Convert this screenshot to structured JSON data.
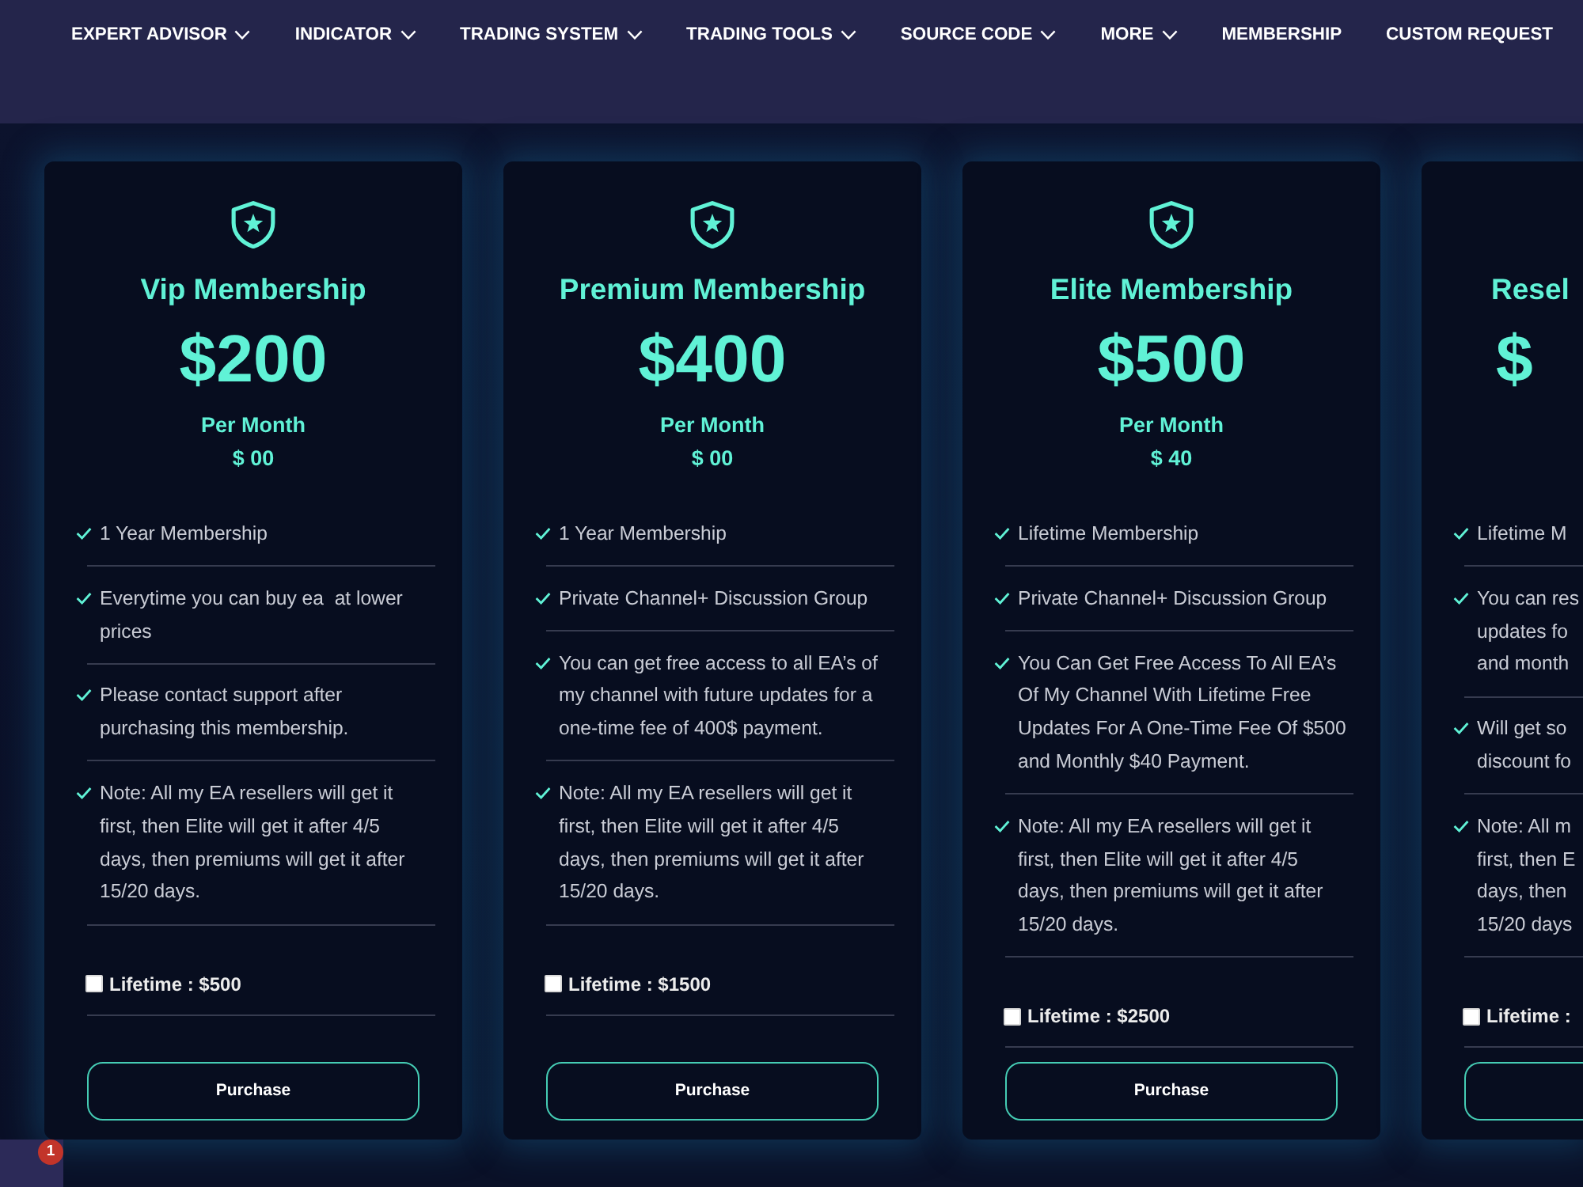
{
  "nav": {
    "items": [
      {
        "label": "EXPERT ADVISOR",
        "dropdown": true
      },
      {
        "label": "INDICATOR",
        "dropdown": true
      },
      {
        "label": "TRADING SYSTEM",
        "dropdown": true
      },
      {
        "label": "TRADING TOOLS",
        "dropdown": true
      },
      {
        "label": "SOURCE CODE",
        "dropdown": true
      },
      {
        "label": "MORE",
        "dropdown": true
      },
      {
        "label": "MEMBERSHIP",
        "dropdown": false
      },
      {
        "label": "CUSTOM REQUEST",
        "dropdown": false
      }
    ]
  },
  "plans": [
    {
      "kind": "full",
      "title": "Vip Membership",
      "price": "$200",
      "period": "Per Month",
      "monthly": "$ 00",
      "items": [
        "1 Year Membership",
        "Everytime you can buy ea  at lower\nprices",
        "Please contact support after\npurchasing this membership.",
        "Note: All my EA resellers will get it\nfirst, then Elite will get it after 4/5\ndays, then premiums will get it after\n15/20 days."
      ],
      "option": {
        "label": "Lifetime : $500",
        "checked": false
      },
      "button": "Purchase"
    },
    {
      "kind": "full",
      "title": "Premium Membership",
      "price": "$400",
      "period": "Per Month",
      "monthly": "$ 00",
      "items": [
        "1 Year Membership",
        "Private Channel+ Discussion Group",
        "You can get free access to all EA’s of\nmy channel with future updates for a\none-time fee of 400$ payment.",
        "Note: All my EA resellers will get it\nfirst, then Elite will get it after 4/5\ndays, then premiums will get it after\n15/20 days."
      ],
      "option": {
        "label": "Lifetime : $1500",
        "checked": false
      },
      "button": "Purchase"
    },
    {
      "kind": "full",
      "title": "Elite Membership",
      "price": "$500",
      "period": "Per Month",
      "monthly": "$ 40",
      "items": [
        "Lifetime Membership",
        "Private Channel+ Discussion Group",
        "You Can Get Free Access To All EA’s\nOf My Channel With Lifetime Free\nUpdates For A One-Time Fee Of $500\nand Monthly $40 Payment.",
        "Note: All my EA resellers will get it\nfirst, then Elite will get it after 4/5\ndays, then premiums will get it after\n15/20 days."
      ],
      "option": {
        "label": "Lifetime : $2500",
        "checked": false
      },
      "button": "Purchase"
    },
    {
      "kind": "cut",
      "title": "Resel",
      "price": "$",
      "items": [
        "Lifetime M",
        "You can res\nupdates fo\nand month",
        "Will get so\ndiscount fo",
        "Note: All m\nfirst, then E\ndays, then\n15/20 days"
      ],
      "option": {
        "label": "Lifetime :",
        "checked": false
      }
    }
  ],
  "chat_widget": {
    "badge": "1"
  }
}
